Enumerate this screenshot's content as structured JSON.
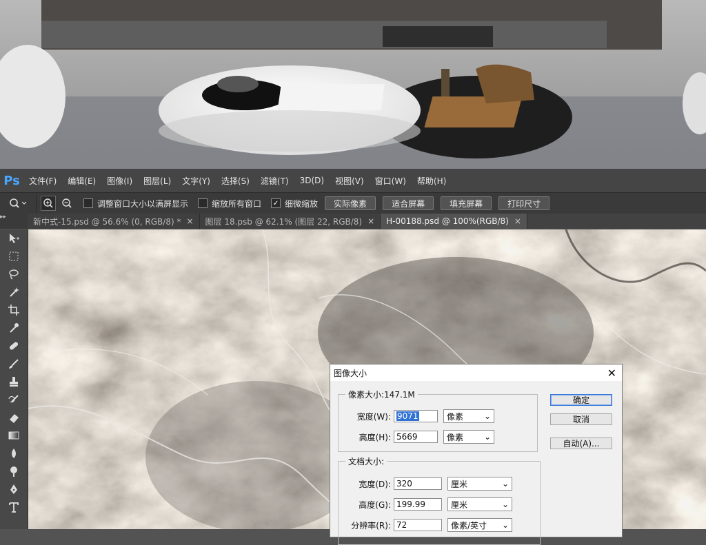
{
  "app": {
    "logo": "Ps"
  },
  "menu": [
    "文件(F)",
    "编辑(E)",
    "图像(I)",
    "图层(L)",
    "文字(Y)",
    "选择(S)",
    "滤镜(T)",
    "3D(D)",
    "视图(V)",
    "窗口(W)",
    "帮助(H)"
  ],
  "options": {
    "tool_icon": "zoom-icon",
    "resize_windows": {
      "label": "调整窗口大小以满屏显示",
      "checked": false
    },
    "zoom_all": {
      "label": "缩放所有窗口",
      "checked": false
    },
    "scrubby_zoom": {
      "label": "细微缩放",
      "checked": true
    },
    "buttons": [
      "实际像素",
      "适合屏幕",
      "填充屏幕",
      "打印尺寸"
    ]
  },
  "tabs": [
    {
      "label": "新中式-15.psd @ 56.6% (0, RGB/8) *",
      "active": false
    },
    {
      "label": "图层 18.psb @ 62.1% (图层 22, RGB/8)",
      "active": false
    },
    {
      "label": "H-00188.psd @ 100%(RGB/8)",
      "active": true
    }
  ],
  "tools": [
    "move-tool-icon",
    "marquee-tool-icon",
    "lasso-tool-icon",
    "magic-wand-icon",
    "crop-tool-icon",
    "eyedropper-icon",
    "healing-brush-icon",
    "brush-tool-icon",
    "clone-stamp-icon",
    "history-brush-icon",
    "eraser-icon",
    "gradient-tool-icon",
    "blur-tool-icon",
    "dodge-tool-icon",
    "pen-tool-icon",
    "type-tool-icon"
  ],
  "dialog": {
    "title": "图像大小",
    "pixel_dims": "像素大小:147.1M",
    "width_label": "宽度(W):",
    "width_value": "9071",
    "width_unit": "像素",
    "height_label": "高度(H):",
    "height_value": "5669",
    "height_unit": "像素",
    "doc_size": "文档大小:",
    "doc_width_label": "宽度(D):",
    "doc_width_value": "320",
    "doc_width_unit": "厘米",
    "doc_height_label": "高度(G):",
    "doc_height_value": "199.99",
    "doc_height_unit": "厘米",
    "res_label": "分辨率(R):",
    "res_value": "72",
    "res_unit": "像素/英寸",
    "ok": "确定",
    "cancel": "取消",
    "auto": "自动(A)..."
  },
  "colors": {
    "accent": "#3072d5",
    "ps_logo": "#4aa6ff"
  }
}
